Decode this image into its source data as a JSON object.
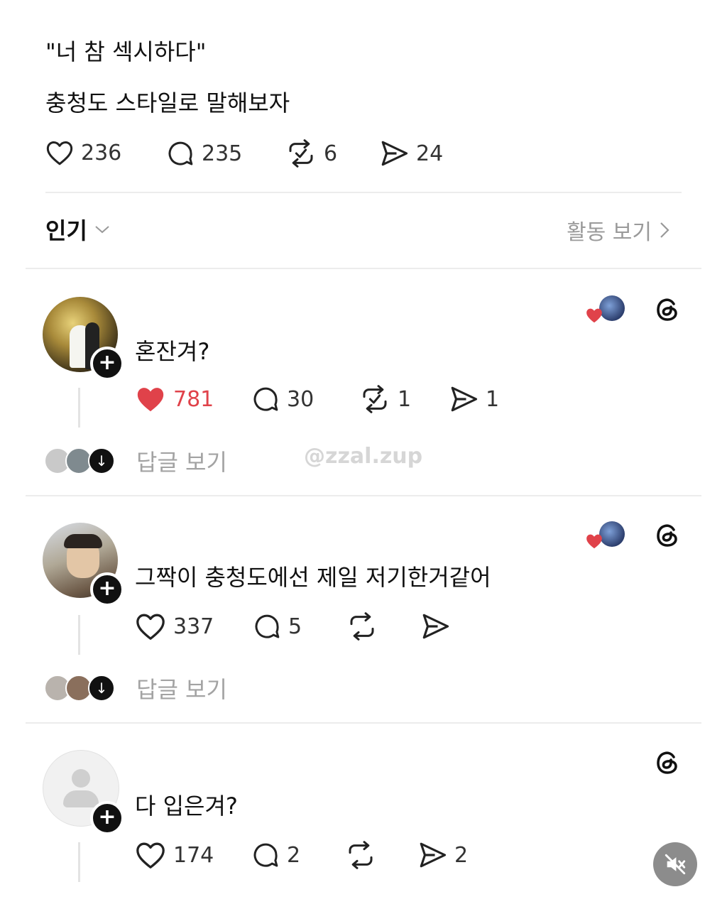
{
  "post": {
    "quote_line": "\"너 참 섹시하다\"",
    "caption": "충청도 스타일로 말해보자",
    "stats": {
      "likes": "236",
      "replies": "235",
      "reposts": "6",
      "shares": "24"
    }
  },
  "sort": {
    "label": "인기"
  },
  "activity": {
    "label": "활동 보기"
  },
  "comments": [
    {
      "text": "혼잔겨?",
      "likes": "781",
      "replies": "30",
      "reposts": "1",
      "shares": "1",
      "liked": true,
      "view_replies": "답글 보기"
    },
    {
      "text": "그짝이 충청도에선 제일 저기한거같어",
      "likes": "337",
      "replies": "5",
      "reposts": "",
      "shares": "",
      "liked": false,
      "view_replies": "답글 보기"
    },
    {
      "text": "다 입은겨?",
      "likes": "174",
      "replies": "2",
      "reposts": "",
      "shares": "2",
      "liked": false
    }
  ],
  "watermark": "@zzal.zup",
  "colors": {
    "like_red": "#e0424a",
    "text": "#111111",
    "muted": "#a3a3a3"
  },
  "icons": [
    "heart-icon",
    "comment-icon",
    "repost-icon",
    "share-icon",
    "threads-icon",
    "plus-icon",
    "chevron-down-icon",
    "chevron-right-icon",
    "mute-icon"
  ]
}
